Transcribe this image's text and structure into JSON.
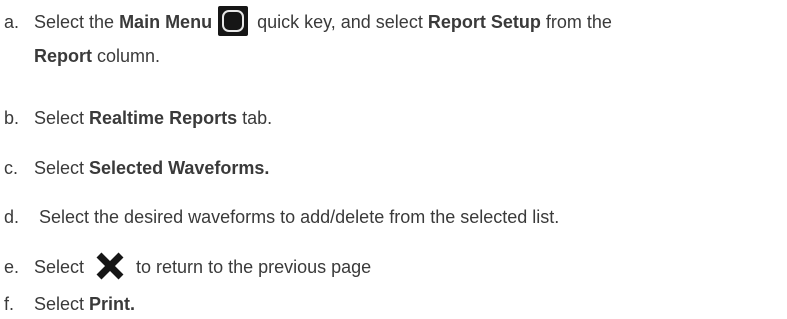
{
  "steps": [
    {
      "marker": "a.",
      "parts": [
        "Select the ",
        "Main Menu",
        " quick key, and select ",
        "Report Setup",
        " from the"
      ],
      "line2_bold": "Report",
      "line2_rest": " column."
    },
    {
      "marker": "b.",
      "parts": [
        "Select ",
        "Realtime Reports",
        " tab."
      ]
    },
    {
      "marker": "c.",
      "parts": [
        "Select ",
        "Selected Waveforms."
      ]
    },
    {
      "marker": "d.",
      "parts": [
        " Select the desired waveforms to add/delete from the selected list."
      ]
    },
    {
      "marker": "e.",
      "parts": [
        "Select ",
        " to return to the previous page"
      ],
      "icon": "close-x-icon"
    },
    {
      "marker": "f.",
      "parts": [
        "Select ",
        "Print."
      ]
    }
  ],
  "icons": {
    "main_menu_key": "main-menu-key-icon",
    "close": "close-x-icon"
  },
  "colors": {
    "text": "#3a3a3a",
    "icon_dark": "#161616"
  }
}
